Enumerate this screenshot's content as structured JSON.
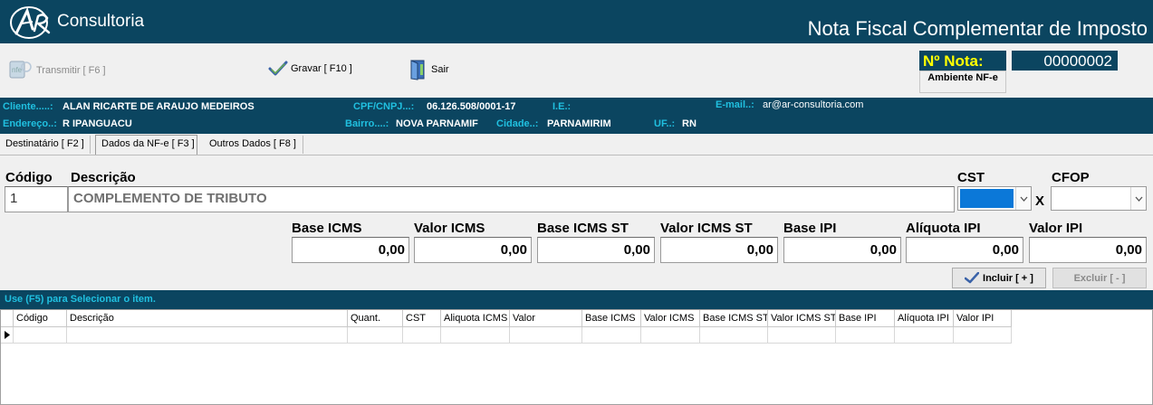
{
  "header": {
    "logo_text": "Consultoria",
    "title": "Nota Fiscal Complementar de Imposto",
    "brand_color": "#0b4560"
  },
  "toolbar": {
    "transmit_label": "Transmitir [ F6 ]",
    "save_label": "Gravar [ F10 ]",
    "exit_label": "Sair",
    "nota_label": "Nº Nota:",
    "nota_number": "00000002",
    "ambiente_label": "Ambiente NF-e"
  },
  "client": {
    "cliente_label": "Cliente.....:",
    "cliente": "ALAN RICARTE DE ARAUJO MEDEIROS",
    "cpf_label": "CPF/CNPJ...:",
    "cpf": "06.126.508/0001-17",
    "ie_label": "I.E.:",
    "ie": "",
    "email_label": "E-mail..:",
    "email": "ar@ar-consultoria.com",
    "endereco_label": "Endereço..:",
    "endereco": "R IPANGUACU",
    "bairro_label": "Bairro....:",
    "bairro": "NOVA PARNAMIF",
    "cidade_label": "Cidade..:",
    "cidade": "PARNAMIRIM",
    "uf_label": "UF..:",
    "uf": "RN"
  },
  "tabs": [
    {
      "label": "Destinatário [ F2 ]"
    },
    {
      "label": "Dados da NF-e [ F3 ]"
    },
    {
      "label": "Outros Dados [ F8 ]"
    }
  ],
  "form": {
    "codigo_label": "Código",
    "codigo": "1",
    "descricao_label": "Descrição",
    "descricao": "COMPLEMENTO DE TRIBUTO",
    "cst_label": "CST",
    "x_label": "X",
    "cfop_label": "CFOP",
    "base_icms_label": "Base ICMS",
    "base_icms": "0,00",
    "valor_icms_label": "Valor ICMS",
    "valor_icms": "0,00",
    "base_icms_st_label": "Base ICMS ST",
    "base_icms_st": "0,00",
    "valor_icms_st_label": "Valor ICMS ST",
    "valor_icms_st": "0,00",
    "base_ipi_label": "Base IPI",
    "base_ipi": "0,00",
    "aliquota_ipi_label": "Alíquota IPI",
    "aliquota_ipi": "0,00",
    "valor_ipi_label": "Valor IPI",
    "valor_ipi": "0,00",
    "incluir_label": "Incluir [ + ]",
    "excluir_label": "Excluir [ - ]"
  },
  "grid": {
    "hint": "Use (F5) para Selecionar o item.",
    "columns": [
      "Código",
      "Descrição",
      "Quant.",
      "CST",
      "Aliquota ICMS",
      "Valor",
      "Base ICMS",
      "Valor ICMS",
      "Base ICMS ST",
      "Valor ICMS ST",
      "Base IPI",
      "Alíquota IPI",
      "Valor IPI"
    ]
  }
}
